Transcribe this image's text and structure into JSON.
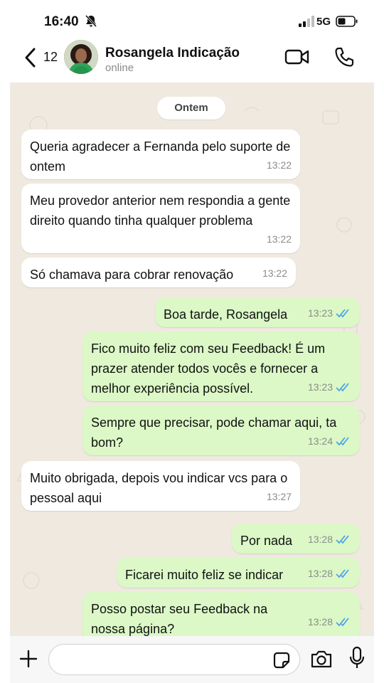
{
  "status_bar": {
    "time": "16:40",
    "network": "5G",
    "icons": [
      "bell-slash-icon",
      "signal-icon",
      "battery-icon"
    ]
  },
  "header": {
    "back_count": "12",
    "contact_name": "Rosangela Indicação",
    "contact_status": "online",
    "icons": [
      "back-chevron-icon",
      "avatar",
      "video-call-icon",
      "phone-call-icon"
    ]
  },
  "chat": {
    "date_separator": "Ontem",
    "messages": [
      {
        "direction": "incoming",
        "text": "Queria agradecer a Fernanda pelo suporte de ontem",
        "time": "13:22"
      },
      {
        "direction": "incoming",
        "text": "Meu provedor anterior nem respondia a gente direito quando tinha qualquer problema",
        "time": "13:22"
      },
      {
        "direction": "incoming",
        "text": "Só chamava para cobrar renovação",
        "time": "13:22"
      },
      {
        "direction": "outgoing",
        "text": "Boa tarde, Rosangela",
        "time": "13:23",
        "status": "read"
      },
      {
        "direction": "outgoing",
        "text": "Fico muito feliz com seu Feedback! É um prazer atender todos vocês e fornecer a melhor experiência possível.",
        "time": "13:23",
        "status": "read"
      },
      {
        "direction": "outgoing",
        "text": "Sempre que precisar, pode chamar aqui, ta bom?",
        "time": "13:24",
        "status": "read"
      },
      {
        "direction": "incoming",
        "text": "Muito obrigada, depois vou indicar vcs para o pessoal aqui",
        "time": "13:27"
      },
      {
        "direction": "outgoing",
        "text": "Por nada",
        "time": "13:28",
        "status": "read"
      },
      {
        "direction": "outgoing",
        "text": "Ficarei muito feliz se indicar",
        "time": "13:28",
        "status": "read"
      },
      {
        "direction": "outgoing",
        "text": "Posso postar seu Feedback na nossa página?",
        "time": "13:28",
        "status": "read"
      }
    ]
  },
  "input_bar": {
    "value": "",
    "icons": [
      "plus-icon",
      "sticker-icon",
      "camera-icon",
      "microphone-icon"
    ]
  },
  "colors": {
    "incoming_bubble": "#ffffff",
    "outgoing_bubble": "#dbf8c6",
    "chat_background": "#efe9e0",
    "read_ticks": "#4fa3e6"
  }
}
